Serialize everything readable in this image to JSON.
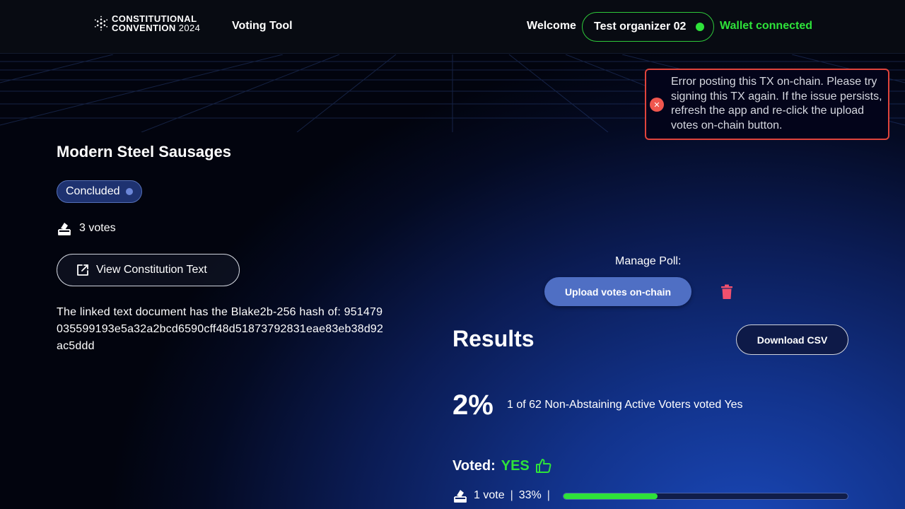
{
  "header": {
    "logo_line1": "CONSTITUTIONAL",
    "logo_line2": "CONVENTION",
    "logo_year": "2024",
    "app_name": "Voting Tool",
    "welcome": "Welcome",
    "user_name": "Test organizer 02",
    "wallet_status": "Wallet connected"
  },
  "toast": {
    "icon": "x-icon",
    "message": "Error posting this TX on-chain. Please try signing this TX again. If the issue persists, refresh the app and re-click the upload votes on-chain button."
  },
  "poll": {
    "title": "Modern Steel Sausages",
    "status": "Concluded",
    "votes_label": "3 votes",
    "view_button": "View Constitution Text",
    "hash_text": "The linked text document has the Blake2b-256 hash of: 951479035599193e5a32a2bcd6590cff48d51873792831eae83eb38d92ac5ddd"
  },
  "manage": {
    "label": "Manage Poll:",
    "upload_button": "Upload votes on-chain",
    "delete_icon": "trash-icon"
  },
  "results": {
    "title": "Results",
    "download_button": "Download CSV",
    "percent": "2%",
    "description": "1 of 62 Non-Abstaining Active Voters voted Yes",
    "voted_label": "Voted:",
    "voted_value": "YES",
    "tally_votes": "1 vote",
    "tally_sep": "|",
    "tally_percent": "33%",
    "progress_fraction": 0.33
  },
  "colors": {
    "accent_green": "#2ee23a",
    "error_red": "#e0443c",
    "primary_blue": "#4f6fc4",
    "delete_red": "#f0506e"
  }
}
